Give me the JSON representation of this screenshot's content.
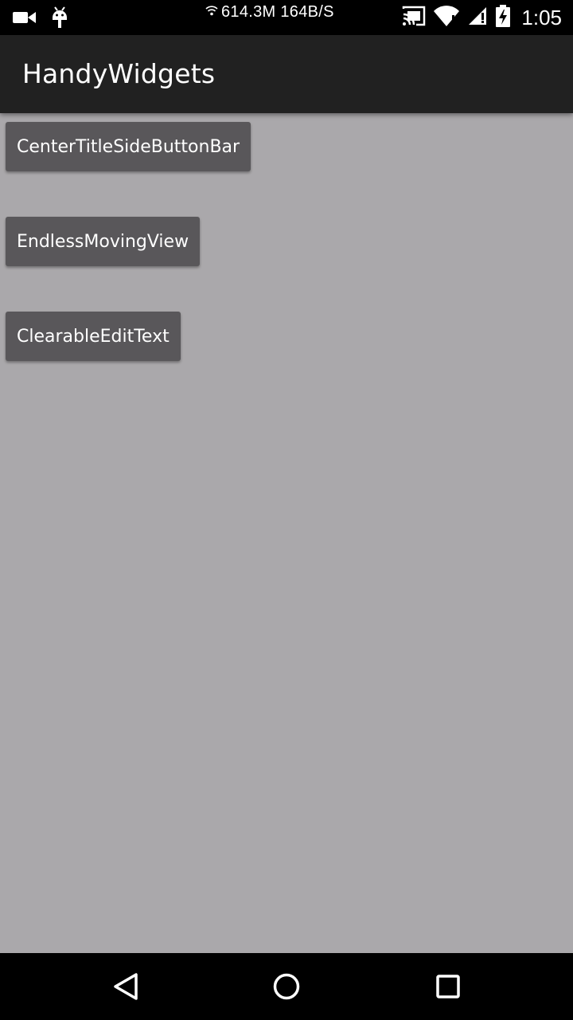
{
  "status_bar": {
    "network_speed": "614.3M 164B/S",
    "time": "1:05",
    "left_icons": [
      "video-camera-icon",
      "android-debug-icon"
    ],
    "right_icons": [
      "cast-icon",
      "wifi-icon",
      "signal-icon",
      "battery-charging-icon"
    ]
  },
  "app_bar": {
    "title": "HandyWidgets"
  },
  "buttons": [
    {
      "label": "CenterTitleSideButtonBar"
    },
    {
      "label": "EndlessMovingView"
    },
    {
      "label": "ClearableEditText"
    }
  ],
  "nav_bar": {
    "icons": [
      "back-icon",
      "home-icon",
      "recents-icon"
    ]
  },
  "colors": {
    "status_bar": "#000000",
    "app_bar": "#212121",
    "background": "#aaa8ab",
    "button": "#59575a",
    "text": "#ffffff"
  }
}
